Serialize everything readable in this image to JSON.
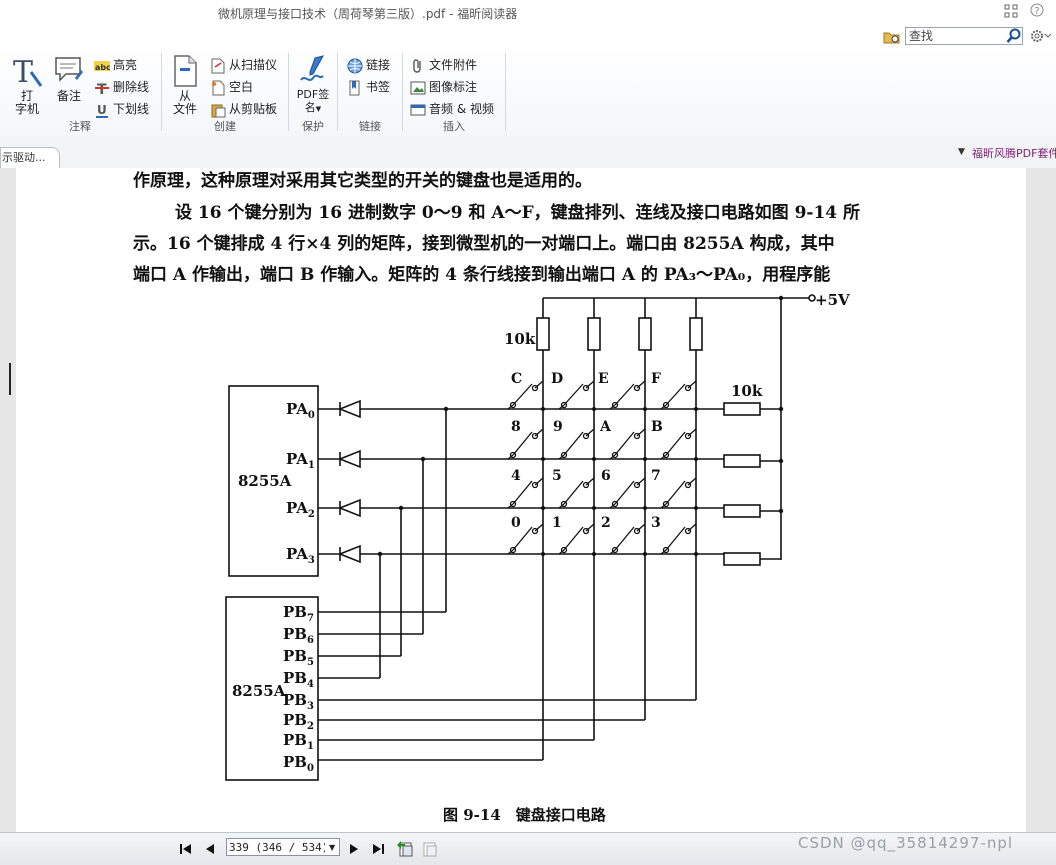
{
  "window": {
    "title": "微机原理与接口技术（周荷琴第三版）.pdf - 福昕阅读器"
  },
  "search": {
    "placeholder": "查找",
    "value": ""
  },
  "ribbon": {
    "groups": [
      {
        "label": "注释",
        "buttons": [
          {
            "label": "打\n字机",
            "icon": "typewriter-icon"
          },
          {
            "label": "备注",
            "icon": "note-icon"
          },
          {
            "label": "高亮",
            "icon": "highlight-icon"
          },
          {
            "label": "删除线",
            "icon": "strikeout-icon"
          },
          {
            "label": "下划线",
            "icon": "underline-icon"
          }
        ]
      },
      {
        "label": "创建",
        "buttons": [
          {
            "label": "从\n文件",
            "icon": "file-icon"
          },
          {
            "label": "从扫描仪",
            "icon": "scanner-icon"
          },
          {
            "label": "空白",
            "icon": "blank-page-icon"
          },
          {
            "label": "从剪贴板",
            "icon": "clipboard-icon"
          }
        ]
      },
      {
        "label": "保护",
        "buttons": [
          {
            "label": "PDF签\n名",
            "icon": "pdf-sign-icon"
          }
        ]
      },
      {
        "label": "链接",
        "buttons": [
          {
            "label": "链接",
            "icon": "link-icon"
          },
          {
            "label": "书签",
            "icon": "bookmark-icon"
          }
        ]
      },
      {
        "label": "插入",
        "buttons": [
          {
            "label": "文件附件",
            "icon": "attachment-icon"
          },
          {
            "label": "图像标注",
            "icon": "image-annotation-icon"
          },
          {
            "label": "音频 & 视频",
            "icon": "audio-video-icon"
          }
        ]
      }
    ]
  },
  "tabs": {
    "doc_tab_label": "示驱动...",
    "ad_text": "福昕风腾PDF套件"
  },
  "document": {
    "lines": [
      "作原理，这种原理对采用其它类型的开关的键盘也是适用的。",
      "设 16 个键分别为 16 进制数字 0～9 和 A～F，键盘排列、连线及接口电路如图 9-14 所",
      "示。16 个键排成 4 行×4 列的矩阵，接到微型机的一对端口上。端口由 8255A 构成，其中",
      "端口 A 作输出，端口 B 作输入。矩阵的 4 条行线接到输出端口 A 的 PA₃～PA₀，用程序能"
    ],
    "figure": {
      "caption": "图 9-14　键盘接口电路",
      "chip_top_label": "8255A",
      "chip_bottom_label": "8255A",
      "pa_pins": [
        "PA",
        "PA",
        "PA",
        "PA"
      ],
      "pa_subs": [
        "0",
        "1",
        "2",
        "3"
      ],
      "pb_pins": [
        "PB",
        "PB",
        "PB",
        "PB",
        "PB",
        "PB",
        "PB",
        "PB"
      ],
      "pb_subs": [
        "7",
        "6",
        "5",
        "4",
        "3",
        "2",
        "1",
        "0"
      ],
      "vcc_label": "+5V",
      "pullup_label": "10k",
      "row_resistor_label": "10k",
      "keys": [
        [
          "C",
          "D",
          "E",
          "F"
        ],
        [
          "8",
          "9",
          "A",
          "B"
        ],
        [
          "4",
          "5",
          "6",
          "7"
        ],
        [
          "0",
          "1",
          "2",
          "3"
        ]
      ]
    }
  },
  "statusbar": {
    "page_field": "339 (346 / 534)",
    "watermark": "CSDN @qq_35814297-npl"
  }
}
